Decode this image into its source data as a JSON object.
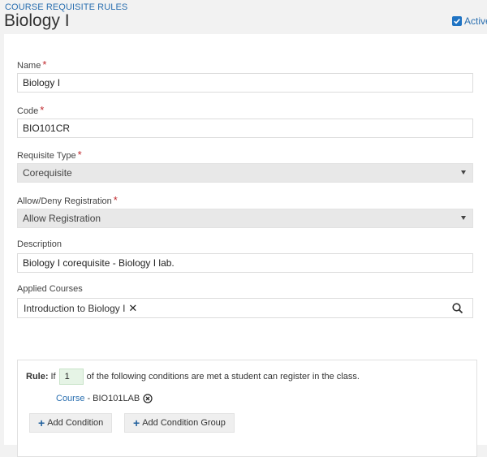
{
  "header": {
    "breadcrumb": "COURSE REQUISITE RULES",
    "title": "Biology I",
    "active_label": "Active",
    "active_checked": true
  },
  "form": {
    "name": {
      "label": "Name",
      "value": "Biology I"
    },
    "code": {
      "label": "Code",
      "value": "BIO101CR"
    },
    "requisite_type": {
      "label": "Requisite Type",
      "value": "Corequisite"
    },
    "allow_deny": {
      "label": "Allow/Deny Registration",
      "value": "Allow Registration"
    },
    "description": {
      "label": "Description",
      "value": "Biology I corequisite - Biology I lab."
    },
    "applied_courses": {
      "label": "Applied Courses",
      "tags": [
        "Introduction to Biology I"
      ]
    },
    "required_marker": "*"
  },
  "rule": {
    "rule_label": "Rule:",
    "if_text": "If",
    "count": "1",
    "suffix": "of the following conditions are met a student can register in the class.",
    "conditions": [
      {
        "type": "Course",
        "separator": "-",
        "value": "BIO101LAB"
      }
    ],
    "add_condition": "Add Condition",
    "add_condition_group": "Add Condition Group"
  },
  "colors": {
    "accent": "#2a6fb0",
    "required": "#c0282d",
    "count_bg": "#e6f4e6"
  },
  "icons": {
    "search": "search-icon",
    "remove": "close-icon",
    "remove_circle": "close-circle-icon",
    "dropdown": "chevron-down-icon",
    "add": "plus-icon",
    "check": "checkmark-icon"
  }
}
